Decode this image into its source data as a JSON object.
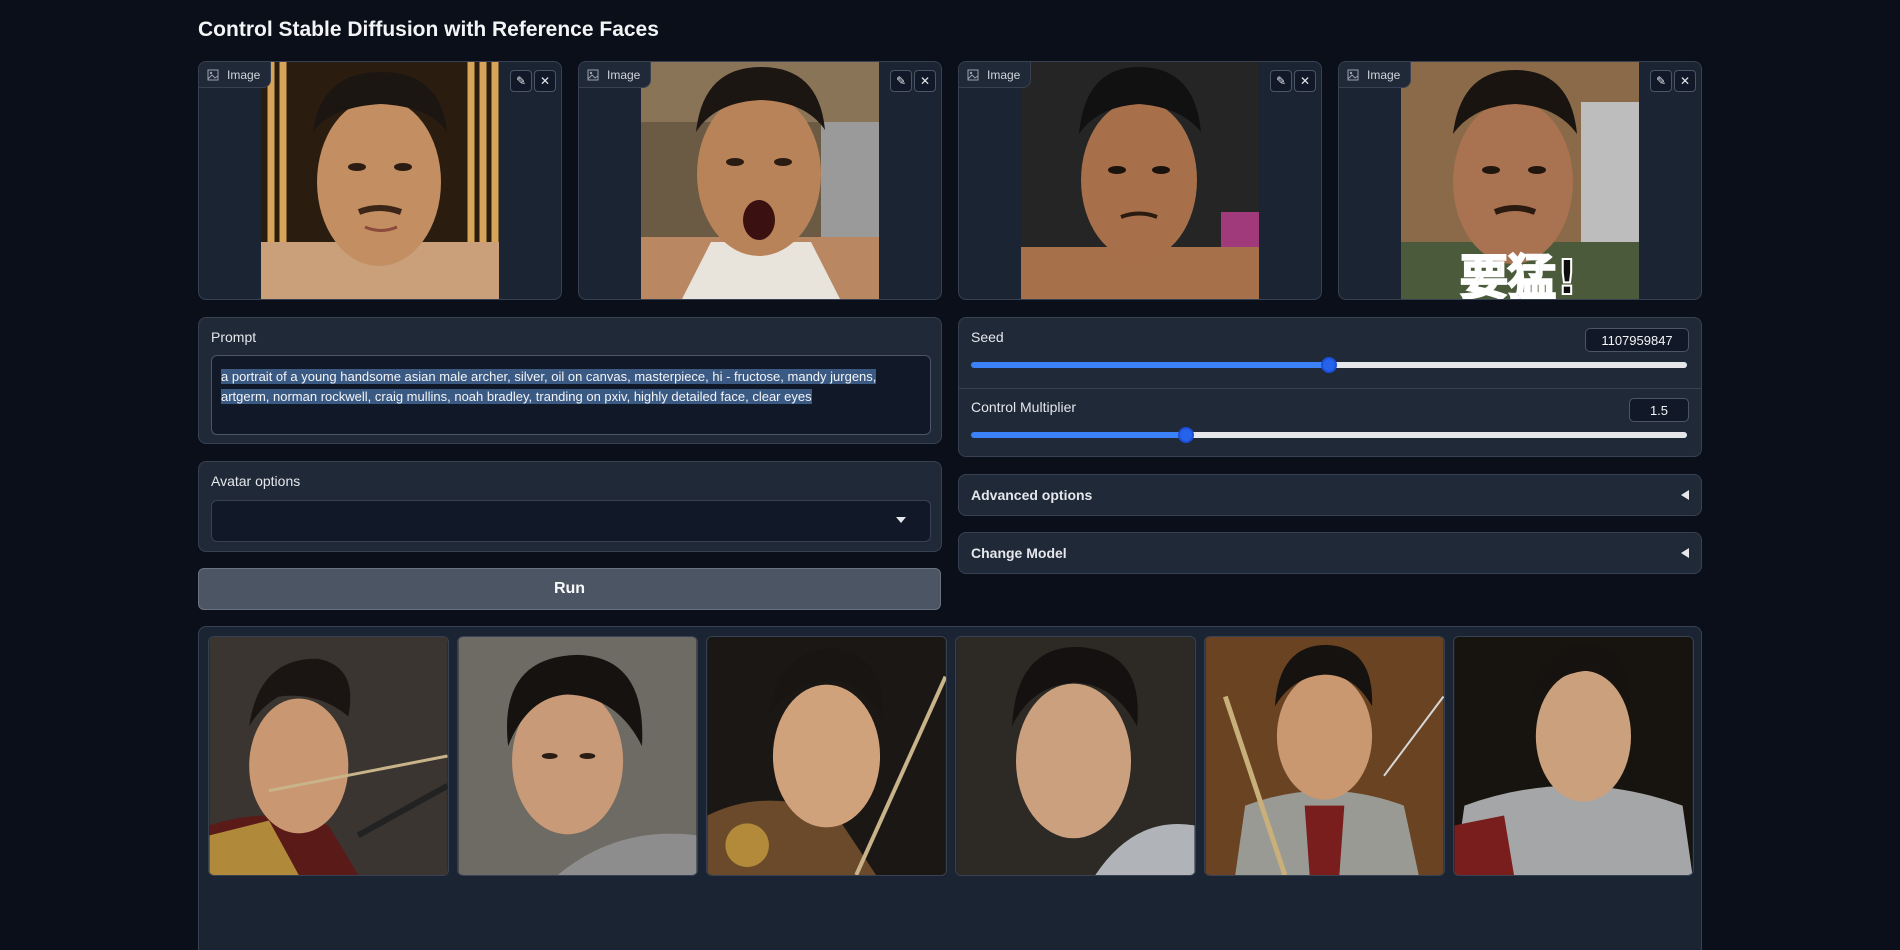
{
  "app": {
    "title": "Control Stable Diffusion with Reference Faces"
  },
  "image_inputs": [
    {
      "label": "Image"
    },
    {
      "label": "Image"
    },
    {
      "label": "Image"
    },
    {
      "label": "Image",
      "overlay_text": "要猛!"
    }
  ],
  "prompt": {
    "label": "Prompt",
    "value": "a portrait of a young handsome asian male archer, silver, oil on canvas, masterpiece, hi - fructose, mandy jurgens, artgerm, norman rockwell, craig mullins, noah bradley, tranding on pxiv, highly detailed face, clear eyes"
  },
  "avatar_options": {
    "label": "Avatar options",
    "selected": ""
  },
  "run_button": {
    "label": "Run"
  },
  "seed": {
    "label": "Seed",
    "value": "1107959847",
    "fraction": 0.5
  },
  "control_multiplier": {
    "label": "Control Multiplier",
    "value": "1.5",
    "fraction": 0.3
  },
  "advanced_options": {
    "label": "Advanced options"
  },
  "change_model": {
    "label": "Change Model"
  },
  "gallery": {
    "count": 6
  },
  "colors": {
    "accent": "#2563eb",
    "background": "#0b0f19",
    "panel": "#1f2937"
  }
}
